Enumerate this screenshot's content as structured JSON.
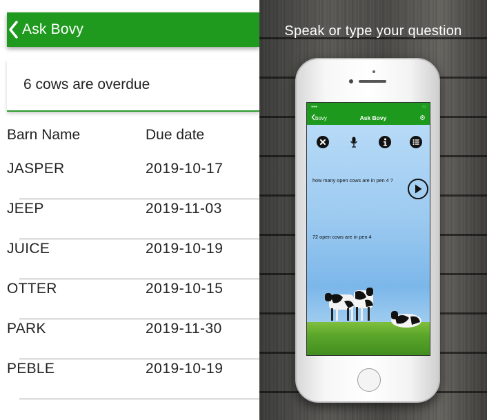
{
  "left": {
    "nav": {
      "back_icon": "chevron-left-icon",
      "title": "Ask Bovy"
    },
    "summary": "6 cows are overdue",
    "table": {
      "headers": [
        "Barn Name",
        "Due date"
      ],
      "rows": [
        {
          "name": "JASPER",
          "due": "2019-10-17"
        },
        {
          "name": "JEEP",
          "due": "2019-11-03"
        },
        {
          "name": "JUICE",
          "due": "2019-10-19"
        },
        {
          "name": "OTTER",
          "due": "2019-10-15"
        },
        {
          "name": "PARK",
          "due": "2019-11-30"
        },
        {
          "name": "PEBLE",
          "due": "2019-10-19"
        }
      ]
    }
  },
  "right": {
    "promo_title": "Speak or type your question",
    "phone": {
      "nav": {
        "back_label": "bovy",
        "title": "Ask Bovy",
        "settings_icon": "gear-icon"
      },
      "toolbar_icons": [
        "close-circle-icon",
        "microphone-icon",
        "info-icon",
        "list-icon"
      ],
      "question": "how many open cows are in pen 4 ?",
      "answer": "72 open cows are in pen 4",
      "play_icon": "play-icon"
    }
  },
  "colors": {
    "brand_green": "#1f9a1f",
    "separator": "#9a9a9a"
  }
}
